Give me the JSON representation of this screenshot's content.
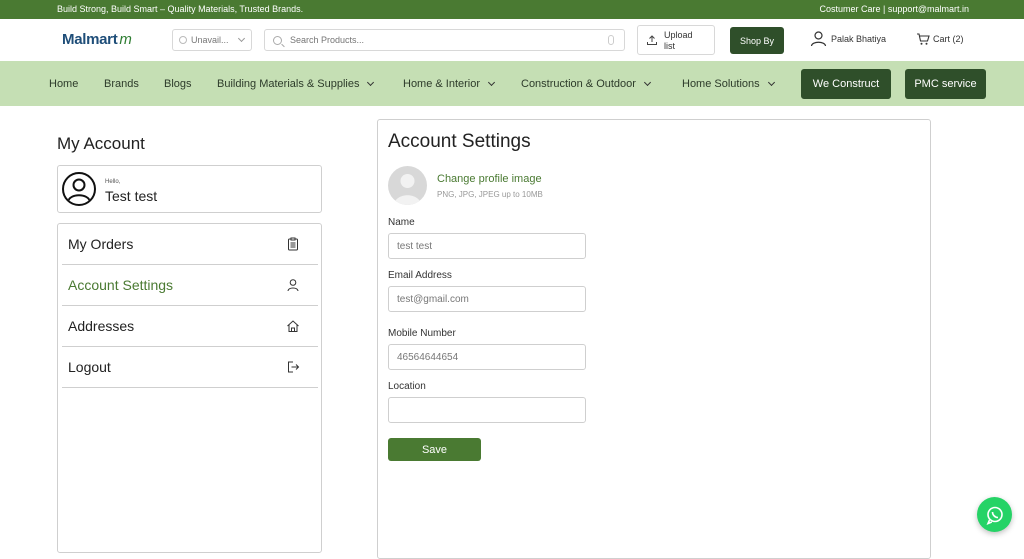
{
  "topbar": {
    "tagline": "Build Strong, Build Smart – Quality Materials, Trusted Brands.",
    "contact": "Costumer Care | support@malmart.in"
  },
  "header": {
    "logo_text": "Malmart",
    "logo_mark": "m",
    "location_label": "Unavail...",
    "search_placeholder": "Search Products...",
    "upload_label": "Upload list",
    "shopby_label": "Shop By",
    "user_name": "Palak Bhatiya",
    "cart_label": "Cart (2)"
  },
  "nav": {
    "items": [
      {
        "label": "Home"
      },
      {
        "label": "Brands"
      },
      {
        "label": "Blogs"
      },
      {
        "label": "Building Materials & Supplies"
      },
      {
        "label": "Home & Interior"
      },
      {
        "label": "Construction & Outdoor"
      },
      {
        "label": "Home Solutions"
      }
    ],
    "buttons": [
      {
        "label": "We Construct"
      },
      {
        "label": "PMC service"
      }
    ]
  },
  "sidebar": {
    "title": "My Account",
    "greeting": "Hello,",
    "user_name": "Test test",
    "menu": [
      {
        "label": "My Orders",
        "icon": "clipboard-icon"
      },
      {
        "label": "Account Settings",
        "icon": "user-icon"
      },
      {
        "label": "Addresses",
        "icon": "home-icon"
      },
      {
        "label": "Logout",
        "icon": "logout-icon"
      }
    ]
  },
  "settings": {
    "title": "Account Settings",
    "change_image": "Change profile image",
    "image_hint": "PNG, JPG, JPEG up to 10MB",
    "fields": [
      {
        "label": "Name",
        "value": "test test"
      },
      {
        "label": "Email Address",
        "value": "test@gmail.com"
      },
      {
        "label": "Mobile Number",
        "value": "46564644654"
      },
      {
        "label": "Location",
        "value": ""
      }
    ],
    "save_label": "Save"
  },
  "colors": {
    "brand_green": "#4a7a32",
    "dark_green": "#2f4f2a",
    "nav_bg": "#c5dfb4",
    "whatsapp": "#25d366"
  }
}
